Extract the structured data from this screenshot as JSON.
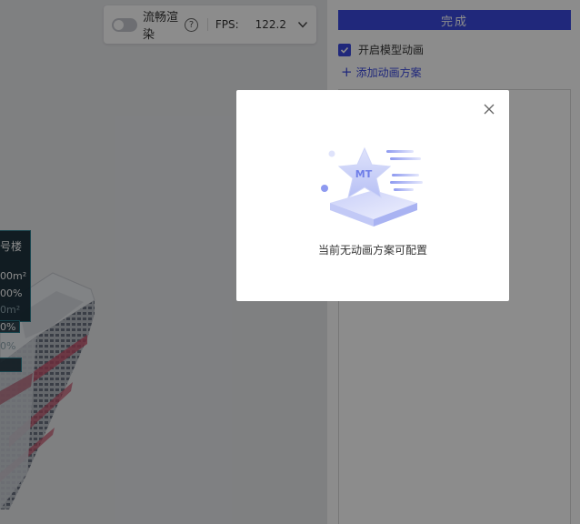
{
  "viewport": {
    "fps_bar": {
      "render_toggle_label": "流畅渲染",
      "help_icon": "question-circle-icon",
      "fps_label": "FPS:",
      "fps_value": "122.2",
      "expand_icon": "chevron-down-icon"
    },
    "info_panel": {
      "title": "号楼",
      "lines": [
        "00m²",
        "00%",
        "0m²",
        "0%",
        "0%"
      ]
    }
  },
  "side_panel": {
    "done_button": "完成",
    "enable_animation": {
      "label": "开启模型动画",
      "checked": true
    },
    "add_scheme": {
      "icon": "plus-icon",
      "label": "添加动画方案"
    }
  },
  "modal": {
    "close_icon": "close-icon",
    "illustration_text": "MT",
    "empty_text": "当前无动画方案可配置"
  },
  "colors": {
    "accent": "#3b49e0",
    "mask": "rgba(0,0,0,0.45)",
    "info_panel_bg": "#122834",
    "building_accent": "#c8506a"
  }
}
